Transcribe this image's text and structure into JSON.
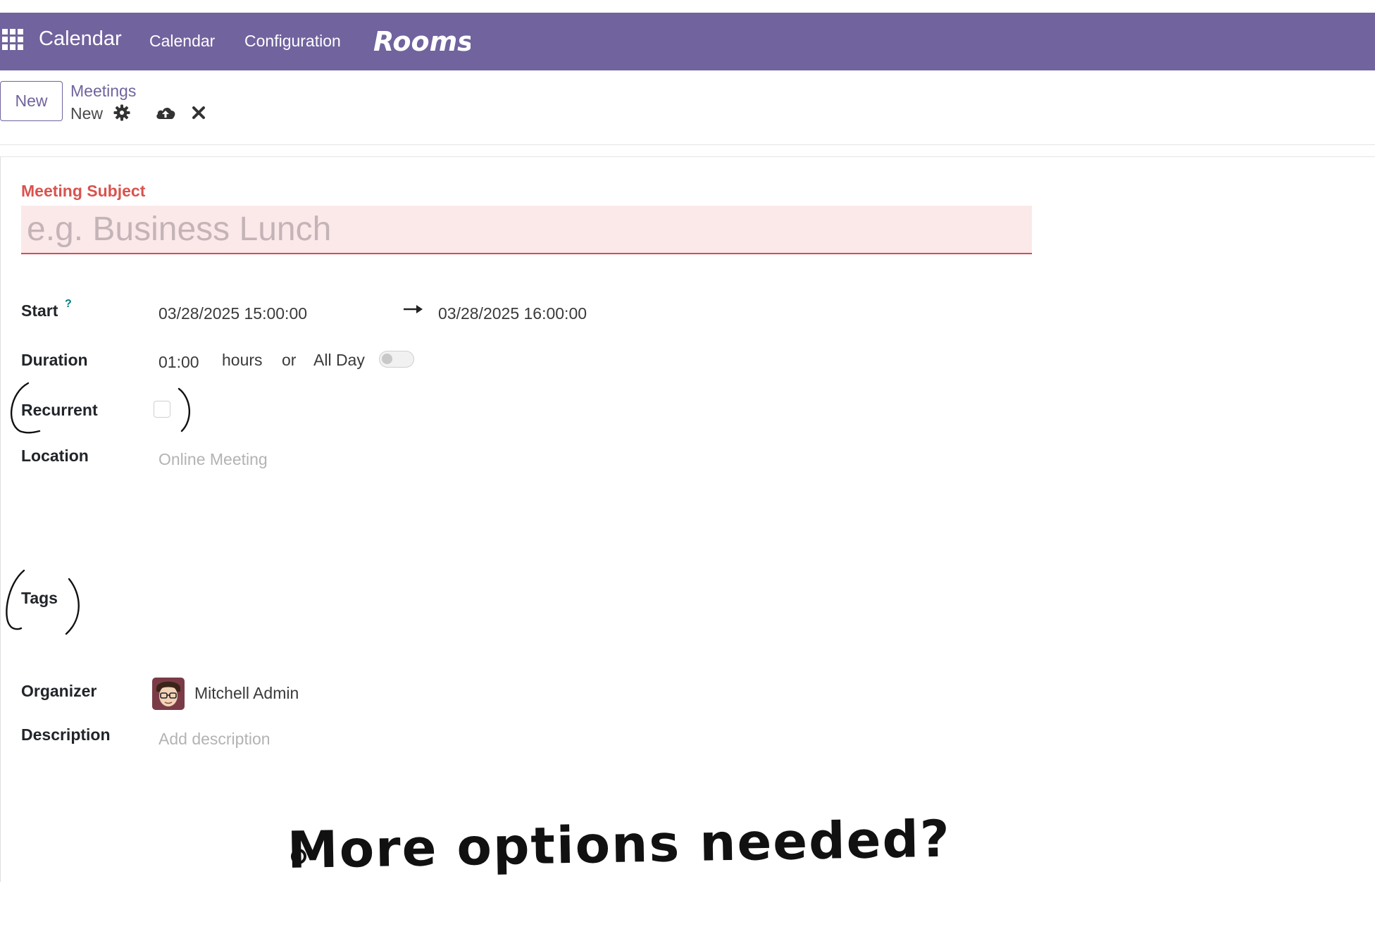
{
  "navbar": {
    "app_name": "Calendar",
    "menu": [
      "Calendar",
      "Configuration"
    ],
    "annotation": "Rooms",
    "color": "#71639e"
  },
  "control_panel": {
    "new_button": "New",
    "breadcrumb_parent": "Meetings",
    "breadcrumb_current": "New",
    "icons": [
      "gear-icon",
      "cloud-upload-icon",
      "close-icon"
    ]
  },
  "form": {
    "subject_label": "Meeting Subject",
    "subject_placeholder": "e.g. Business Lunch",
    "start_label": "Start",
    "start_help": "?",
    "start_value": "03/28/2025 15:00:00",
    "stop_value": "03/28/2025 16:00:00",
    "duration_label": "Duration",
    "duration_value": "01:00",
    "hours_text": "hours",
    "or_text": "or",
    "allday_text": "All Day",
    "allday_on": false,
    "recurrent_label": "Recurrent",
    "recurrent_checked": false,
    "location_label": "Location",
    "location_placeholder": "Online Meeting",
    "tags_label": "Tags",
    "organizer_label": "Organizer",
    "organizer_value": "Mitchell Admin",
    "description_label": "Description",
    "description_placeholder": "Add description"
  },
  "annotations": {
    "note": "More options needed?",
    "circled_fields": [
      "Recurrent",
      "Tags"
    ]
  }
}
